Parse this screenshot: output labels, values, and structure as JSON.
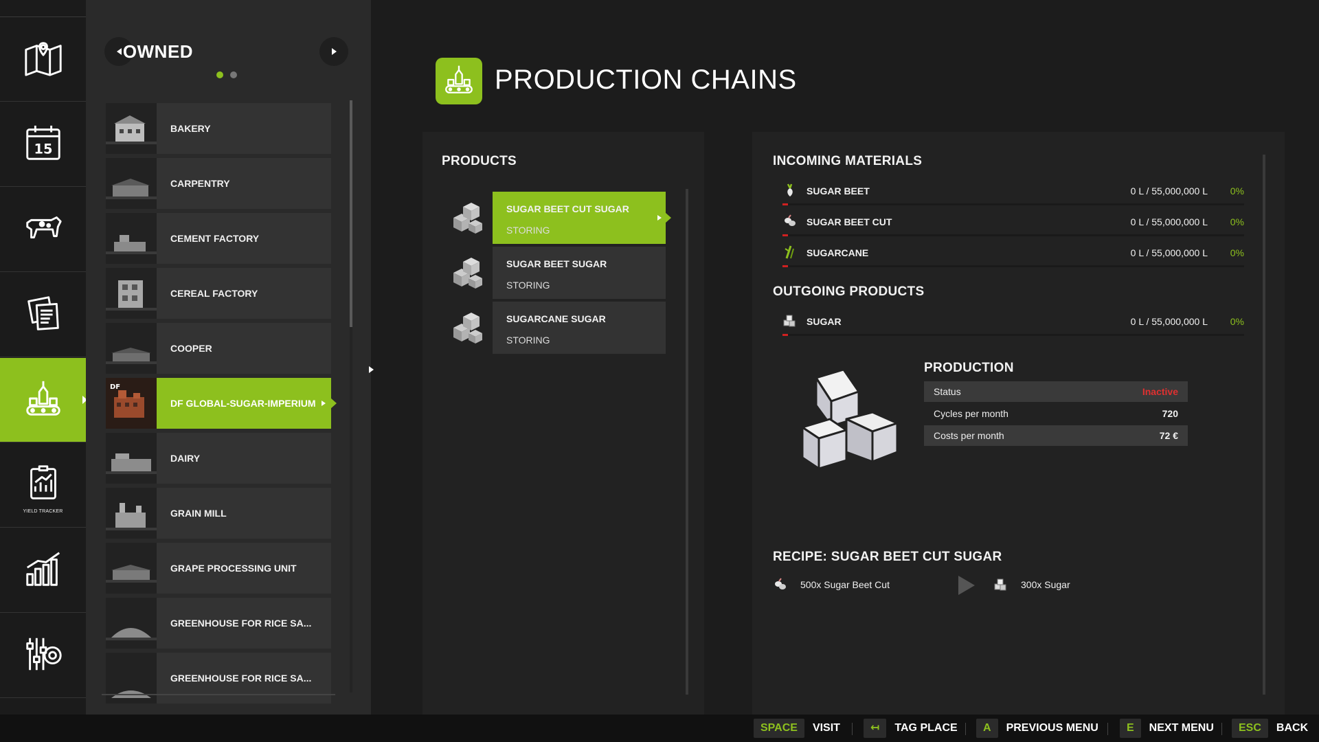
{
  "nav": {
    "items": [
      {
        "icon": "map-icon"
      },
      {
        "icon": "calendar-icon",
        "calendar_day": "15"
      },
      {
        "icon": "animals-icon"
      },
      {
        "icon": "contracts-icon"
      },
      {
        "icon": "production-icon",
        "active": true
      },
      {
        "icon": "yield-tracker-icon",
        "label": "YIELD TRACKER"
      },
      {
        "icon": "statistics-icon"
      },
      {
        "icon": "settings-icon"
      }
    ]
  },
  "owned": {
    "title": "OWNED",
    "page_count": 2,
    "current_page": 1,
    "items": [
      {
        "label": "BAKERY"
      },
      {
        "label": "CARPENTRY"
      },
      {
        "label": "CEMENT FACTORY"
      },
      {
        "label": "CEREAL FACTORY"
      },
      {
        "label": "COOPER"
      },
      {
        "label": "DF GLOBAL-SUGAR-IMPERIUM",
        "active": true
      },
      {
        "label": "DAIRY"
      },
      {
        "label": "GRAIN MILL"
      },
      {
        "label": "GRAPE PROCESSING UNIT"
      },
      {
        "label": "GREENHOUSE FOR RICE SA..."
      },
      {
        "label": "GREENHOUSE FOR RICE SA..."
      }
    ]
  },
  "header": {
    "title": "PRODUCTION CHAINS",
    "icon": "production-icon"
  },
  "products": {
    "title": "PRODUCTS",
    "items": [
      {
        "name": "SUGAR BEET CUT SUGAR",
        "status": "STORING",
        "active": true
      },
      {
        "name": "SUGAR BEET SUGAR",
        "status": "STORING"
      },
      {
        "name": "SUGARCANE SUGAR",
        "status": "STORING"
      }
    ]
  },
  "incoming": {
    "title": "INCOMING MATERIALS",
    "items": [
      {
        "icon": "sugar-beet-icon",
        "name": "SUGAR BEET",
        "amount": "0 L / 55,000,000 L",
        "percent": "0%",
        "fill": 0.0
      },
      {
        "icon": "sugar-beet-cut-icon",
        "name": "SUGAR BEET CUT",
        "amount": "0 L / 55,000,000 L",
        "percent": "0%",
        "fill": 0.0
      },
      {
        "icon": "sugarcane-icon",
        "name": "SUGARCANE",
        "amount": "0 L / 55,000,000 L",
        "percent": "0%",
        "fill": 0.0
      }
    ]
  },
  "outgoing": {
    "title": "OUTGOING PRODUCTS",
    "items": [
      {
        "icon": "sugar-icon",
        "name": "SUGAR",
        "amount": "0 L / 55,000,000 L",
        "percent": "0%",
        "fill": 0.0
      }
    ]
  },
  "production": {
    "title": "PRODUCTION",
    "rows": [
      {
        "key": "Status",
        "value": "Inactive"
      },
      {
        "key": "Cycles per month",
        "value": "720"
      },
      {
        "key": "Costs per month",
        "value": "72 €"
      }
    ]
  },
  "recipe": {
    "title": "RECIPE: SUGAR BEET CUT SUGAR",
    "input": {
      "icon": "sugar-beet-cut-icon",
      "text": "500x Sugar Beet Cut"
    },
    "output": {
      "icon": "sugar-icon",
      "text": "300x Sugar"
    }
  },
  "hints": [
    {
      "key": "SPACE",
      "action": "VISIT"
    },
    {
      "key": "↤",
      "action": "TAG PLACE"
    },
    {
      "key": "A",
      "action": "PREVIOUS MENU"
    },
    {
      "key": "E",
      "action": "NEXT MENU"
    },
    {
      "key": "ESC",
      "action": "BACK"
    }
  ],
  "colors": {
    "accent": "#8dc01e",
    "inactive": "#e03030",
    "fill_bar": "#d02020"
  }
}
